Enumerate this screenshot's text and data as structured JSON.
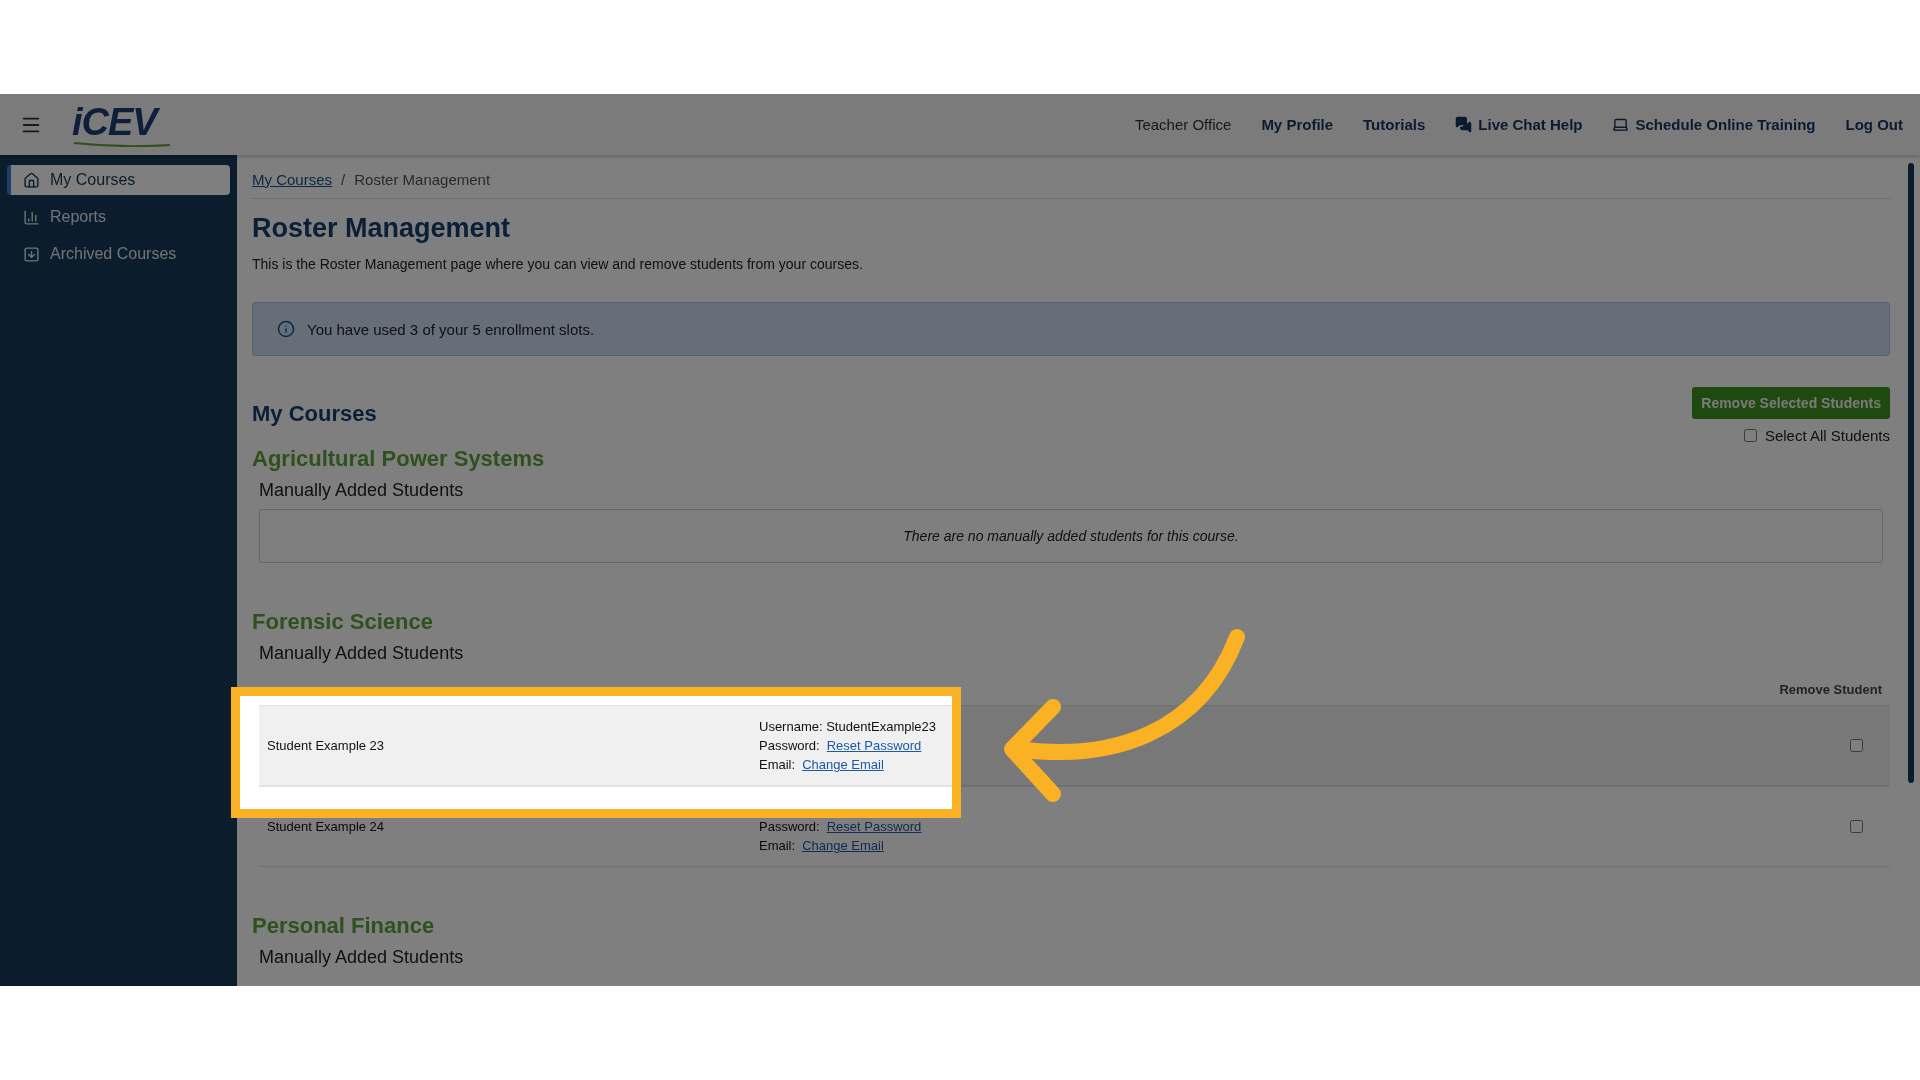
{
  "header": {
    "logo": "iCEV",
    "nav": [
      {
        "label": "Teacher Office",
        "kind": "plain"
      },
      {
        "label": "My Profile",
        "kind": "link"
      },
      {
        "label": "Tutorials",
        "kind": "link"
      },
      {
        "label": "Live Chat Help",
        "kind": "chat"
      },
      {
        "label": "Schedule Online Training",
        "kind": "training"
      },
      {
        "label": "Log Out",
        "kind": "link"
      }
    ]
  },
  "sidebar": {
    "items": [
      {
        "label": "My Courses",
        "kind": "home",
        "selected": true
      },
      {
        "label": "Reports",
        "kind": "reports",
        "selected": false
      },
      {
        "label": "Archived Courses",
        "kind": "archive",
        "selected": false
      }
    ]
  },
  "breadcrumb": [
    {
      "label": "My Courses",
      "kind": "link"
    },
    {
      "label": "/",
      "kind": "separator"
    },
    {
      "label": "Roster Management",
      "kind": "current"
    }
  ],
  "title": "Roster Management",
  "description": "This is the Roster Management page where you can view and remove students from your courses.",
  "alert": "You have used 3 of your 5 enrollment slots.",
  "courses_heading": "My Courses",
  "remove_button": "Remove Selected Students",
  "select_all": {
    "label": "Select All Students",
    "checked": false
  },
  "courses": [
    {
      "title": "Agricultural Power Systems",
      "subtitle": "Manually Added Students",
      "empty_message": "There are no manually added students for this course."
    },
    {
      "title": "Forensic Science",
      "subtitle": "Manually Added Students",
      "column_header": "Remove Student",
      "students": [
        {
          "name": "Student Example 23",
          "username": "Username: StudentExample23",
          "password_label": "Password:",
          "password_link": "Reset Password",
          "email_label": "Email:",
          "email_link": "Change Email",
          "checked": false
        },
        {
          "name": "Student Example 24",
          "password_label": "Password:",
          "password_link": "Reset Password",
          "email_label": "Email:",
          "email_link": "Change Email",
          "checked": false
        }
      ]
    },
    {
      "title": "Personal Finance",
      "subtitle": "Manually Added Students"
    }
  ]
}
